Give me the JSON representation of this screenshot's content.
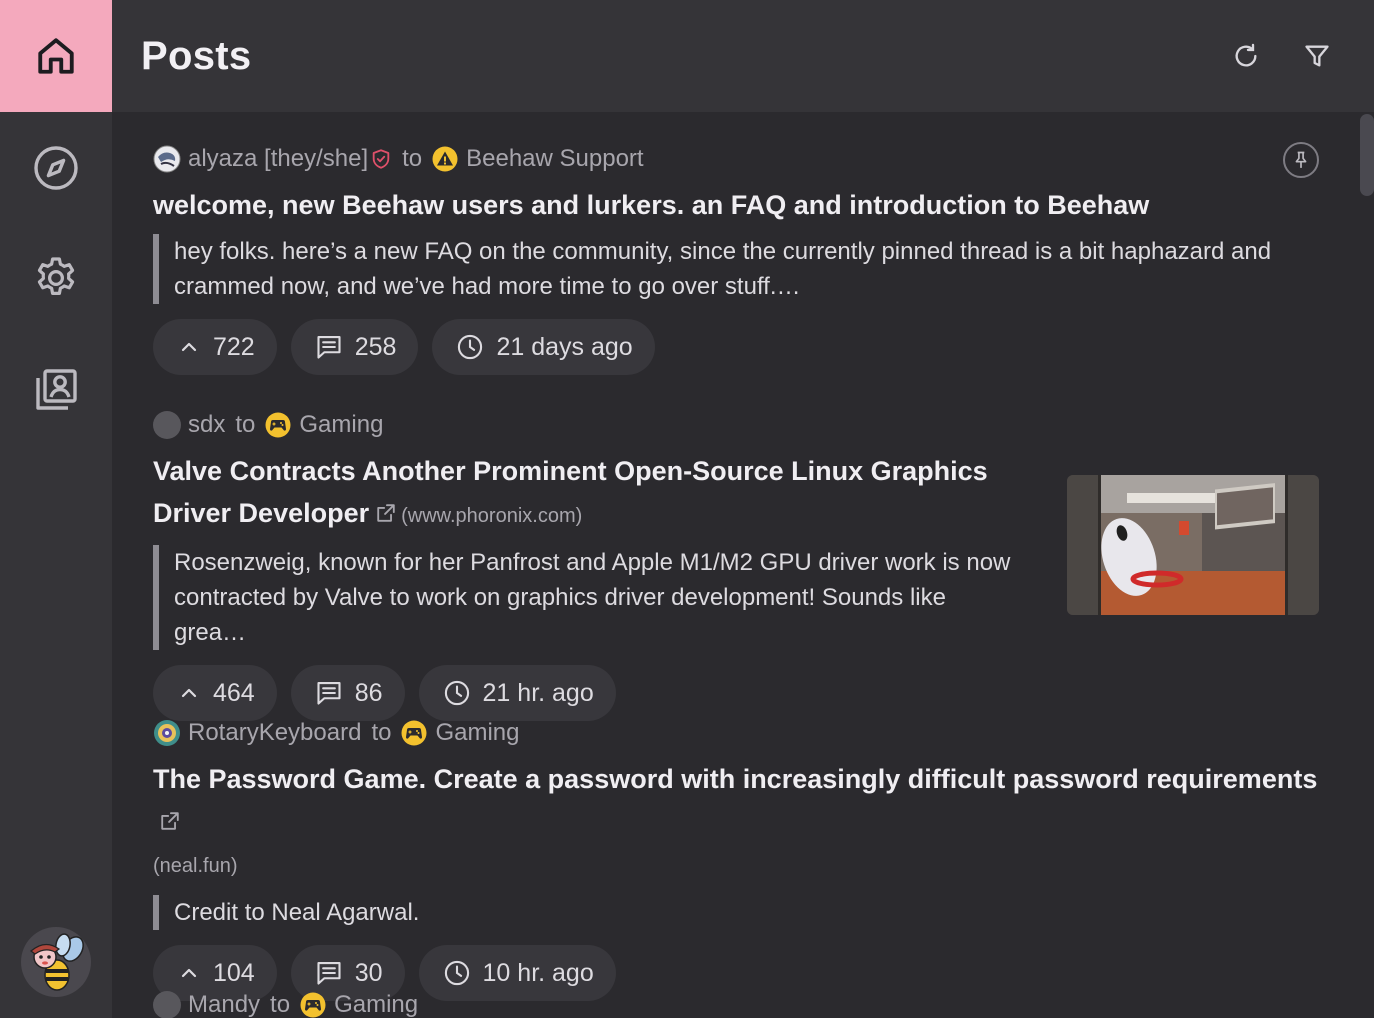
{
  "header": {
    "title": "Posts"
  },
  "nav": {
    "items": [
      "home-icon",
      "compass-icon",
      "gear-icon",
      "profile-library-icon"
    ]
  },
  "toolbar": {
    "icons": [
      "refresh-icon",
      "filter-icon"
    ]
  },
  "posts": [
    {
      "author": "alyaza [they/she]",
      "to": "to",
      "community": "Beehaw Support",
      "title": "welcome, new Beehaw users and lurkers. an FAQ and introduction to Beehaw",
      "excerpt": "hey folks. here’s a new FAQ on the community, since the currently pinned thread is a bit haphazard and crammed now, and we’ve had more time to go over stuff.…",
      "score": "722",
      "comments": "258",
      "time": "21 days ago"
    },
    {
      "author": "sdx",
      "to": "to",
      "community": "Gaming",
      "title": "Valve Contracts Another Prominent Open-Source Linux Graphics Driver Developer",
      "domain": "(www.phoronix.com)",
      "excerpt": "Rosenzweig, known for her Panfrost and Apple M1/M2 GPU driver work is now contracted by Valve to work on graphics driver development! Sounds like grea…",
      "score": "464",
      "comments": "86",
      "time": "21 hr. ago"
    },
    {
      "author": "RotaryKeyboard",
      "to": "to",
      "community": "Gaming",
      "title": "The Password Game. Create a password with increasingly difficult password requirements",
      "domain": "(neal.fun)",
      "excerpt": "Credit to Neal Agarwal.",
      "score": "104",
      "comments": "30",
      "time": "10 hr. ago"
    },
    {
      "author": "Mandy",
      "to": "to",
      "community": "Gaming"
    }
  ],
  "colors": {
    "accent": "#f4a9bd",
    "background": "#2b2a2e",
    "surface": "#353438",
    "pill": "#38373c",
    "mod_shield": "#e0506a"
  }
}
